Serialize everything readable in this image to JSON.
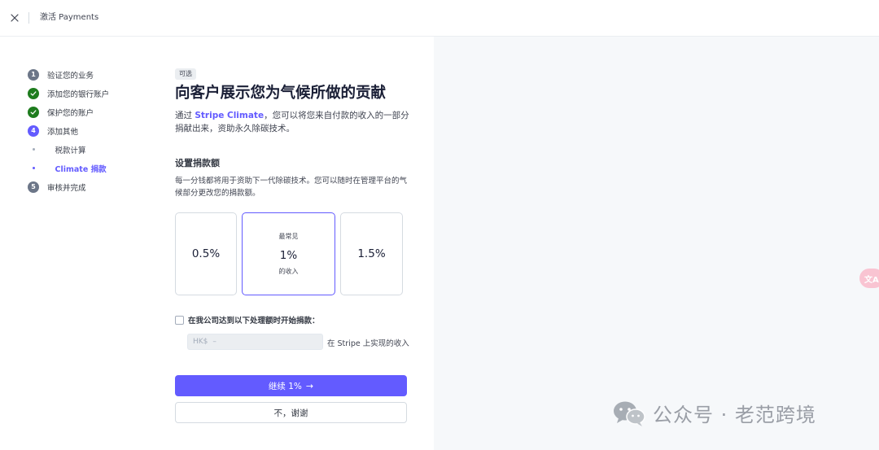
{
  "topbar": {
    "title": "激活 Payments"
  },
  "steps": [
    {
      "number": "1",
      "label": "验证您的业务",
      "state": "pending"
    },
    {
      "number": "",
      "label": "添加您的银行账户",
      "state": "done"
    },
    {
      "number": "",
      "label": "保护您的账户",
      "state": "done"
    },
    {
      "number": "4",
      "label": "添加其他",
      "state": "current"
    },
    {
      "number": "5",
      "label": "审核并完成",
      "state": "pending"
    }
  ],
  "substeps": [
    {
      "label": "税款计算",
      "active": false
    },
    {
      "label": "Climate 捐款",
      "active": true
    }
  ],
  "main": {
    "badge": "可选",
    "heading": "向客户展示您为气候所做的贡献",
    "intro_prefix": "通过 ",
    "intro_link": "Stripe Climate",
    "intro_suffix": "，您可以将您来自付款的收入的一部分捐献出来，资助永久除碳技术。"
  },
  "donation": {
    "title": "设置捐款额",
    "description": "每一分钱都将用于资助下一代除碳技术。您可以随时在管理平台的气候部分更改您的捐款额。",
    "options": [
      {
        "top": "",
        "value": "0.5%",
        "bottom": ""
      },
      {
        "top": "最常见",
        "value": "1%",
        "bottom": "的收入"
      },
      {
        "top": "",
        "value": "1.5%",
        "bottom": ""
      }
    ],
    "selected_option": "1%"
  },
  "threshold": {
    "checkbox_label": "在我公司达到以下处理额时开始捐款：",
    "checked": false,
    "currency_prefix": "HK$",
    "placeholder": "–",
    "suffix": "在 Stripe 上实现的收入"
  },
  "buttons": {
    "continue_label": "继续 1%",
    "continue_arrow": "→",
    "decline_label": "不，谢谢"
  },
  "overlay": {
    "translate_glyph": "文A",
    "watermark_text": "公众号 · 老范跨境"
  },
  "colors": {
    "accent": "#635bff",
    "success": "#1e7c1e",
    "muted": "#6c7688"
  }
}
